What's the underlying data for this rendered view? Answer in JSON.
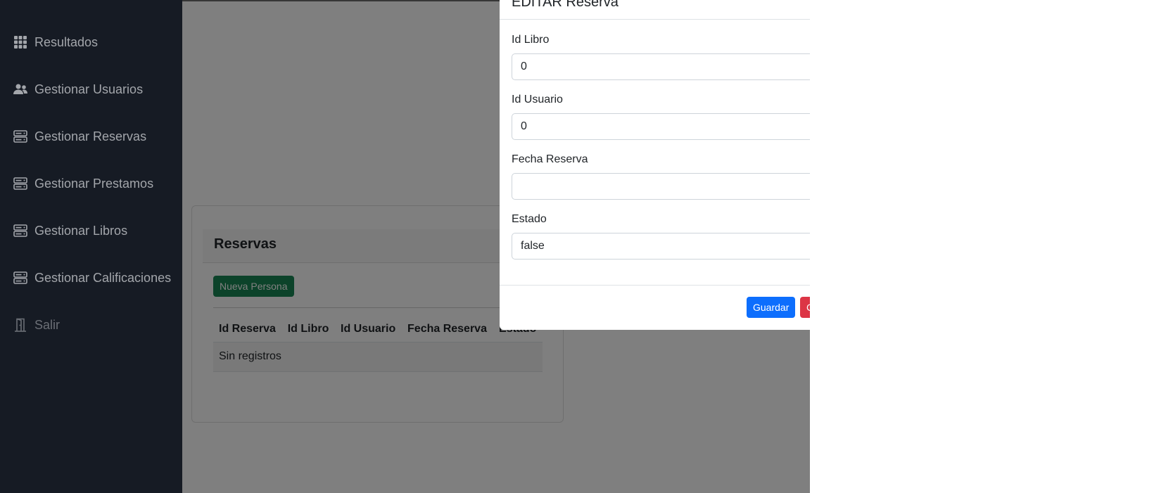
{
  "sidebar": {
    "items": [
      {
        "label": "Resultados",
        "icon": "grid-icon"
      },
      {
        "label": "Gestionar Usuarios",
        "icon": "users-icon"
      },
      {
        "label": "Gestionar Reservas",
        "icon": "server-icon"
      },
      {
        "label": "Gestionar Prestamos",
        "icon": "server-icon"
      },
      {
        "label": "Gestionar Libros",
        "icon": "server-icon"
      },
      {
        "label": "Gestionar Calificaciones",
        "icon": "server-icon"
      },
      {
        "label": "Salir",
        "icon": "door-icon"
      }
    ]
  },
  "card": {
    "title": "Reservas",
    "new_button_label": "Nueva Persona",
    "table": {
      "columns": [
        "Id Reserva",
        "Id Libro",
        "Id Usuario",
        "Fecha Reserva",
        "Estado"
      ],
      "empty_text": "Sin registros"
    }
  },
  "modal": {
    "title": "EDITAR Reserva",
    "fields": [
      {
        "label": "Id Libro",
        "value": "0"
      },
      {
        "label": "Id Usuario",
        "value": "0"
      },
      {
        "label": "Fecha Reserva",
        "value": ""
      },
      {
        "label": "Estado",
        "value": "false"
      }
    ],
    "save_label": "Guardar",
    "close_label": "Cerrar"
  },
  "colors": {
    "sidebar_bg": "#161b24",
    "primary": "#0d6efd",
    "success": "#198754",
    "danger": "#dc3545"
  }
}
